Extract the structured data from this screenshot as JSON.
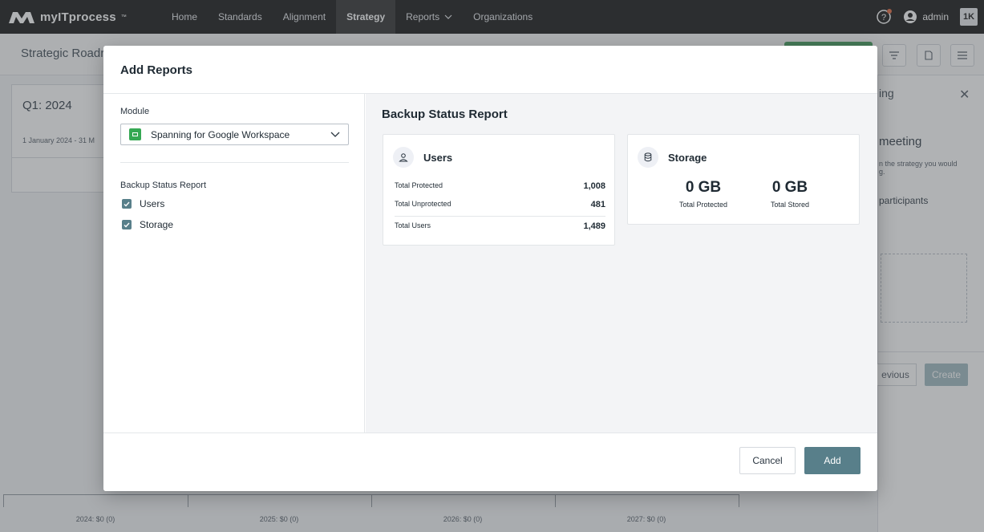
{
  "nav": {
    "brand": "myITprocess",
    "brand_tm": "™",
    "items": [
      "Home",
      "Standards",
      "Alignment",
      "Strategy",
      "Reports",
      "Organizations"
    ],
    "active": "Strategy",
    "user": "admin",
    "badge": "1K"
  },
  "background": {
    "page_title": "Strategic Roadr",
    "q1_title": "Q1: 2024",
    "q1_date": "1 January 2024 - 31 M",
    "side_panel": {
      "title": "ing",
      "meeting": "meeting",
      "description": "n the strategy you would",
      "description2": "g.",
      "participants": "participants",
      "previous": "evious",
      "create": "Create"
    },
    "timeline_labels": [
      "2024: $0 (0)",
      "2025: $0 (0)",
      "2026: $0 (0)",
      "2027: $0 (0)"
    ]
  },
  "modal": {
    "title": "Add Reports",
    "module_label": "Module",
    "module_value": "Spanning for Google Workspace",
    "group_label": "Backup Status Report",
    "options": [
      {
        "label": "Users",
        "checked": true
      },
      {
        "label": "Storage",
        "checked": true
      }
    ],
    "report_title": "Backup Status Report",
    "users_card": {
      "title": "Users",
      "rows": [
        {
          "label": "Total Protected",
          "value": "1,008"
        },
        {
          "label": "Total Unprotected",
          "value": "481"
        },
        {
          "label": "Total Users",
          "value": "1,489"
        }
      ]
    },
    "storage_card": {
      "title": "Storage",
      "stats": [
        {
          "value": "0 GB",
          "label": "Total Protected"
        },
        {
          "value": "0 GB",
          "label": "Total Stored"
        }
      ]
    },
    "cancel": "Cancel",
    "add": "Add"
  },
  "colors": {
    "accent": "#587f8a",
    "nav_bg": "#0f0f0f",
    "sheets_green": "#35a853"
  }
}
